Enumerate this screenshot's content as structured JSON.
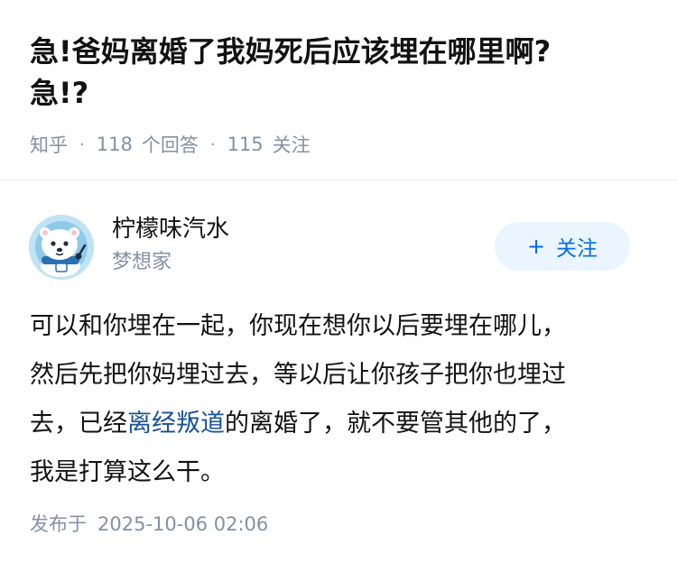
{
  "question": {
    "title_line1": "急!爸妈离婚了我妈死后应该埋在哪里啊?",
    "title_line2": "急!?",
    "source": "知乎",
    "separator": "·",
    "answer_count": "118",
    "answer_label": "个回答",
    "follower_count": "115",
    "follower_label": "关注"
  },
  "author": {
    "name": "柠檬味汽水",
    "headline": "梦想家",
    "follow_plus": "+",
    "follow_label": "关注"
  },
  "answer": {
    "line1": "可以和你埋在一起，你现在想你以后要埋在哪儿，",
    "line2": "然后先把你妈埋过去，等以后让你孩子把你也埋过",
    "line3_before": "去，已经",
    "line3_keyword": "离经叛道",
    "line3_after": "的离婚了，就不要管其他的了，",
    "line4": "我是打算这么干。"
  },
  "footer": {
    "publish_label": "发布于",
    "publish_time": "2025-10-06 02:06"
  },
  "colors": {
    "accent": "#056de8",
    "follow_bg": "#ebf5ff",
    "muted_text": "#8590a6",
    "keyword_link": "#175199",
    "avatar_bg": "#bfe3f5"
  },
  "icons": {
    "avatar": "polar-bear-cartoon-avatar",
    "follow": "plus-icon"
  }
}
